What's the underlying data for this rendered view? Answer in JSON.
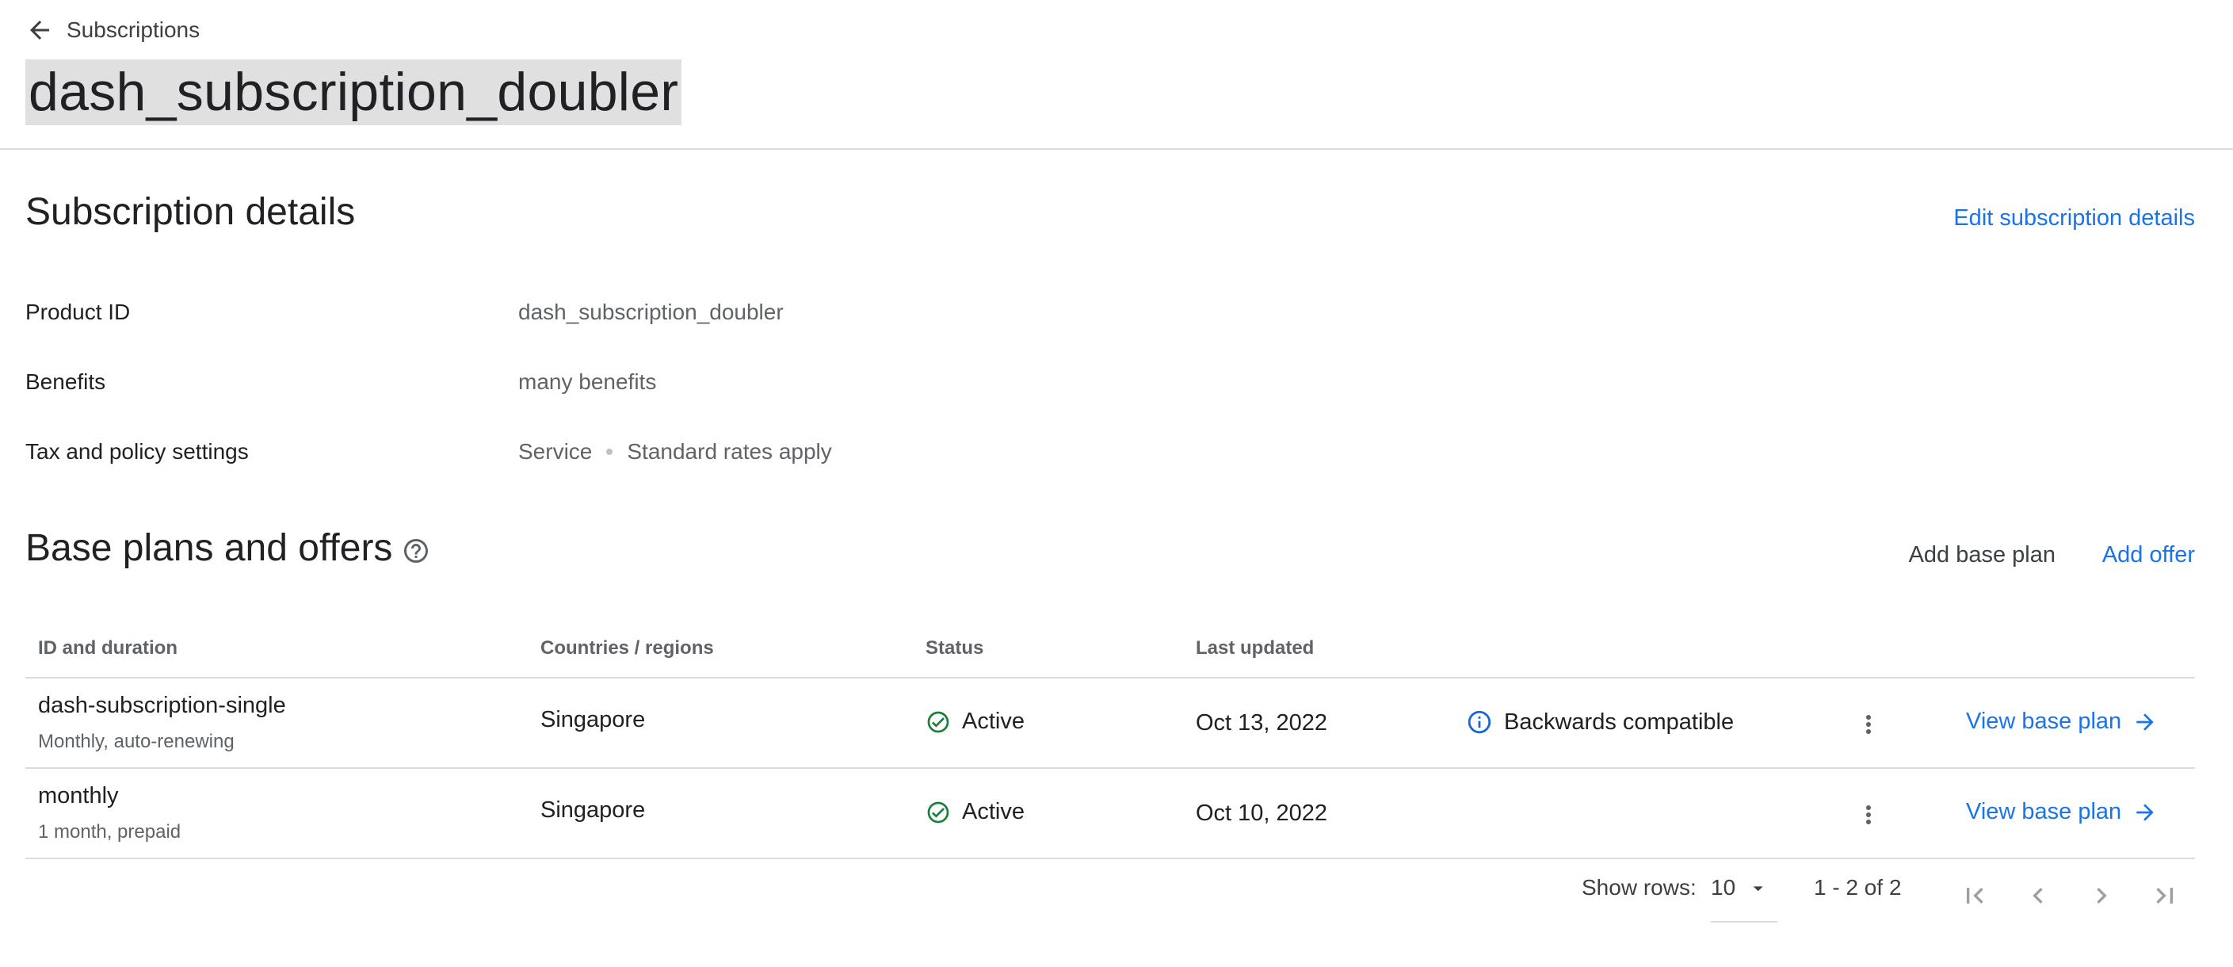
{
  "header": {
    "back_label": "Subscriptions",
    "title": "dash_subscription_doubler"
  },
  "details": {
    "title": "Subscription details",
    "edit_label": "Edit subscription details",
    "rows": [
      {
        "label": "Product ID",
        "value": "dash_subscription_doubler"
      },
      {
        "label": "Benefits",
        "value": "many benefits"
      },
      {
        "label": "Tax and policy settings",
        "value": "Service",
        "value2": "Standard rates apply"
      }
    ]
  },
  "plans": {
    "title": "Base plans and offers",
    "add_base_label": "Add base plan",
    "add_offer_label": "Add offer",
    "columns": [
      "ID and duration",
      "Countries / regions",
      "Status",
      "Last updated"
    ],
    "rows": [
      {
        "id": "dash-subscription-single",
        "duration": "Monthly, auto-renewing",
        "regions": "Singapore",
        "status": "Active",
        "updated": "Oct 13, 2022",
        "note": "Backwards compatible",
        "action": "View base plan"
      },
      {
        "id": "monthly",
        "duration": "1 month, prepaid",
        "regions": "Singapore",
        "status": "Active",
        "updated": "Oct 10, 2022",
        "note": "",
        "action": "View base plan"
      }
    ]
  },
  "pagination": {
    "show_rows_label": "Show rows:",
    "rows_value": "10",
    "range": "1 - 2 of 2"
  },
  "colors": {
    "link": "#1a73e8",
    "active_green": "#188038",
    "info_blue": "#1967d2",
    "title_highlight": "#e0e0e0"
  },
  "icons": {
    "back": "arrow-left-icon",
    "help": "help-circle-icon",
    "status": "check-circle-icon",
    "info": "info-icon",
    "more": "more-vert-icon",
    "arrow": "arrow-right-icon",
    "dropdown": "caret-down-icon",
    "first": "first-page-icon",
    "prev": "chevron-left-icon",
    "next": "chevron-right-icon",
    "last": "last-page-icon"
  }
}
